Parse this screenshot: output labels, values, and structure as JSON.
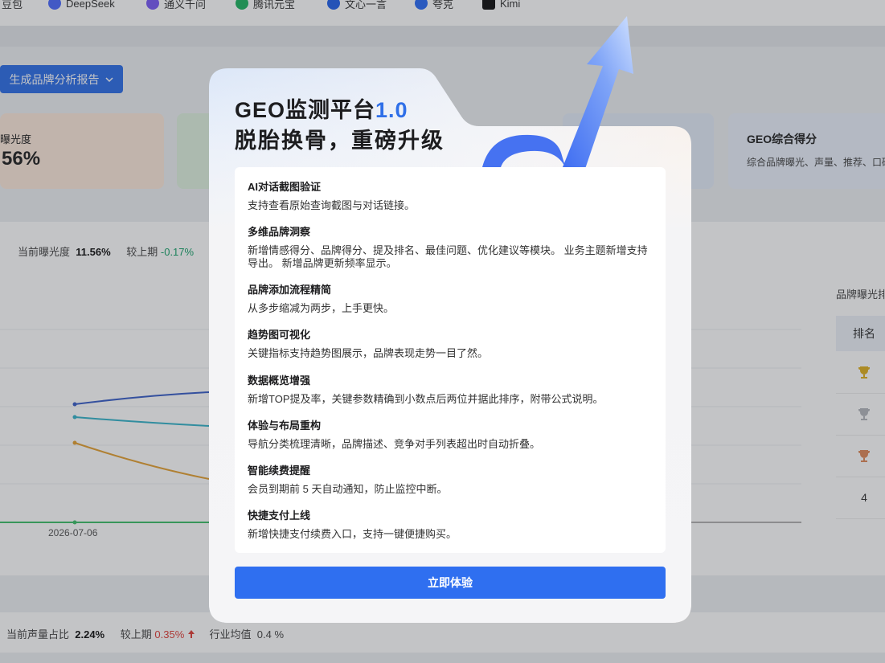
{
  "topbar": {
    "ai_items": [
      {
        "label": "豆包",
        "icon": "doubao-icon",
        "color": "#6b7cff"
      },
      {
        "label": "DeepSeek",
        "icon": "deepseek-icon",
        "color": "#4d6bfe"
      },
      {
        "label": "通义千问",
        "icon": "tongyi-icon",
        "color": "#7b5cf5"
      },
      {
        "label": "腾讯元宝",
        "icon": "yuanbao-icon",
        "color": "#1fb462"
      },
      {
        "label": "文心一言",
        "icon": "wenxin-icon",
        "color": "#2463eb"
      },
      {
        "label": "夸克",
        "icon": "quark-icon",
        "color": "#2b6cf5"
      },
      {
        "label": "Kimi",
        "icon": "kimi-icon",
        "color": "#111111"
      }
    ]
  },
  "toolbar": {
    "report_button": "生成品牌分析报告",
    "report_chevron": "chevron-down-icon"
  },
  "cards": {
    "exposure_label": "曝光度",
    "exposure_value": "56%",
    "geo_title": "GEO综合得分",
    "geo_desc": "综合品牌曝光、声量、推荐、口碑"
  },
  "exposure_stats": {
    "current_label": "当前曝光度",
    "current_value": "11.56%",
    "prev_label": "较上期",
    "prev_value": "-0.17%"
  },
  "chart_data": {
    "type": "line",
    "x": [
      "2026-07-06"
    ],
    "series": [
      {
        "color": "#3a5fc8"
      },
      {
        "color": "#35b3c9"
      },
      {
        "color": "#e5a133"
      },
      {
        "color": "#3fbf6a"
      }
    ]
  },
  "ranking": {
    "title": "品牌曝光排",
    "header": "排名",
    "rows": [
      {
        "icon": "gold-trophy-icon",
        "color": "#e0b020"
      },
      {
        "icon": "silver-trophy-icon",
        "color": "#b5b8bd"
      },
      {
        "icon": "bronze-trophy-icon",
        "color": "#e08a5a"
      },
      {
        "label": "4"
      }
    ]
  },
  "voice_stats": {
    "current_label": "当前声量占比",
    "current_value": "2.24%",
    "prev_label": "较上期",
    "prev_value": "0.35%",
    "industry_label": "行业均值",
    "industry_value": "0.4 %"
  },
  "modal": {
    "title_main": "GEO监测平台",
    "title_version": "1.0",
    "subtitle": "脱胎换骨，重磅升级",
    "features": [
      {
        "title": "AI对话截图验证",
        "desc": "支持查看原始查询截图与对话链接。"
      },
      {
        "title": "多维品牌洞察",
        "desc": "新增情感得分、品牌得分、提及排名、最佳问题、优化建议等模块。 业务主题新增支持导出。 新增品牌更新频率显示。"
      },
      {
        "title": "品牌添加流程精简",
        "desc": "从多步缩减为两步，上手更快。"
      },
      {
        "title": "趋势图可视化",
        "desc": "关键指标支持趋势图展示，品牌表现走势一目了然。"
      },
      {
        "title": "数据概览增强",
        "desc": "新增TOP提及率，关键参数精确到小数点后两位并据此排序，附带公式说明。"
      },
      {
        "title": "体验与布局重构",
        "desc": "导航分类梳理清晰，品牌描述、竞争对手列表超出时自动折叠。"
      },
      {
        "title": "智能续费提醒",
        "desc": "会员到期前 5 天自动通知，防止监控中断。"
      },
      {
        "title": "快捷支付上线",
        "desc": "新增快捷支付续费入口，支持一键便捷购买。"
      }
    ],
    "cta_label": "立即体验",
    "accent": "#2f6ff0"
  }
}
